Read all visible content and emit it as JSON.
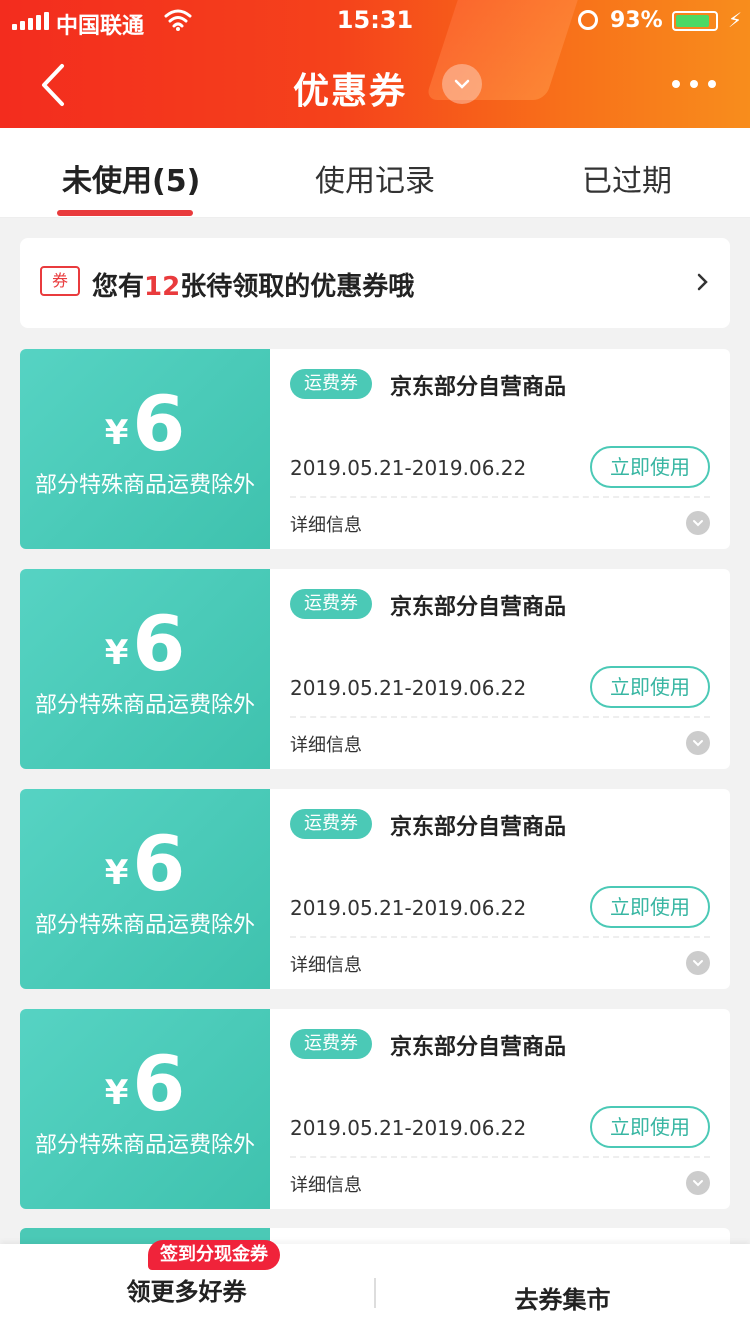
{
  "status_bar": {
    "carrier": "中国联通",
    "time": "15:31",
    "battery_percent": "93%"
  },
  "nav": {
    "title": "优惠券"
  },
  "tabs": [
    {
      "label": "未使用(5)",
      "active": true
    },
    {
      "label": "使用记录",
      "active": false
    },
    {
      "label": "已过期",
      "active": false
    }
  ],
  "banner": {
    "icon_label": "券",
    "text_before": "您有",
    "count": "12",
    "text_after": "张待领取的优惠券哦"
  },
  "coupons": [
    {
      "currency": "¥",
      "amount": "6",
      "desc": "部分特殊商品运费除外",
      "tag": "运费券",
      "title": "京东部分自营商品",
      "date_range": "2019.05.21-2019.06.22",
      "button": "立即使用",
      "detail_label": "详细信息"
    },
    {
      "currency": "¥",
      "amount": "6",
      "desc": "部分特殊商品运费除外",
      "tag": "运费券",
      "title": "京东部分自营商品",
      "date_range": "2019.05.21-2019.06.22",
      "button": "立即使用",
      "detail_label": "详细信息"
    },
    {
      "currency": "¥",
      "amount": "6",
      "desc": "部分特殊商品运费除外",
      "tag": "运费券",
      "title": "京东部分自营商品",
      "date_range": "2019.05.21-2019.06.22",
      "button": "立即使用",
      "detail_label": "详细信息"
    },
    {
      "currency": "¥",
      "amount": "6",
      "desc": "部分特殊商品运费除外",
      "tag": "运费券",
      "title": "京东部分自营商品",
      "date_range": "2019.05.21-2019.06.22",
      "button": "立即使用",
      "detail_label": "详细信息"
    }
  ],
  "bottom_bar": {
    "badge": "签到分现金券",
    "left_label": "领更多好券",
    "right_label": "去券集市"
  },
  "colors": {
    "header_start": "#f32c1e",
    "header_end": "#f88d1c",
    "accent_red": "#e93b3d",
    "coupon_teal": "#4bc9b6"
  }
}
